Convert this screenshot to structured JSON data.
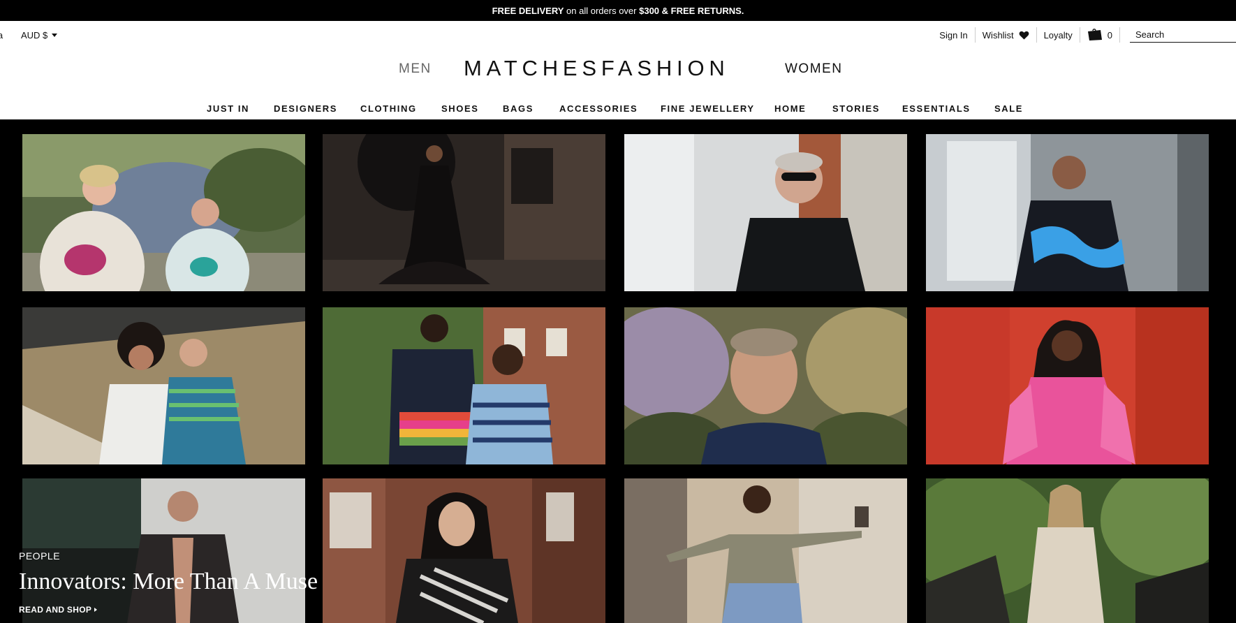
{
  "promo": {
    "free_delivery": "FREE DELIVERY",
    "middle": " on all orders over ",
    "threshold": "$300",
    "tail": " & FREE RETURNS."
  },
  "utility": {
    "region": "ia",
    "currency": "AUD $",
    "sign_in": "Sign In",
    "wishlist": "Wishlist",
    "loyalty": "Loyalty",
    "bag_count": "0",
    "search_placeholder": "Search"
  },
  "header": {
    "men": "MEN",
    "logo": "MATCHESFASHION",
    "women": "WOMEN"
  },
  "nav": [
    "JUST IN",
    "DESIGNERS",
    "CLOTHING",
    "SHOES",
    "BAGS",
    "ACCESSORIES",
    "FINE JEWELLERY",
    "HOME",
    "STORIES",
    "ESSENTIALS",
    "SALE"
  ],
  "hero": {
    "kicker": "PEOPLE",
    "headline": "Innovators: More Than A Muse",
    "cta": "READ AND SHOP"
  },
  "colors": {
    "promo_bg": "#000000",
    "hero_bg": "#000000",
    "text": "#111111"
  }
}
